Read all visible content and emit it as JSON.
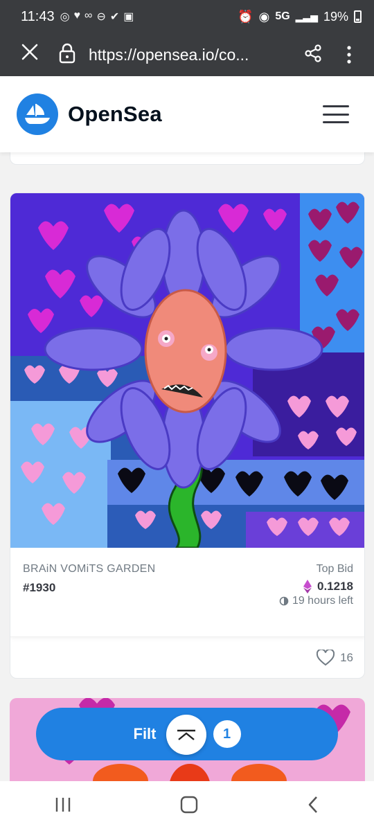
{
  "status_bar": {
    "time": "11:43",
    "network": "5G",
    "battery": "19%"
  },
  "browser": {
    "url": "https://opensea.io/co..."
  },
  "header": {
    "brand": "OpenSea"
  },
  "nft_card": {
    "collection": "BRAiN VOMiTS GARDEN",
    "token": "#1930",
    "top_bid_label": "Top Bid",
    "price": "0.1218",
    "time_left": "19 hours left",
    "likes": "16"
  },
  "filter": {
    "label": "Filt",
    "count": "1"
  },
  "colors": {
    "accent": "#2081e2",
    "eth": "#c74dce"
  }
}
